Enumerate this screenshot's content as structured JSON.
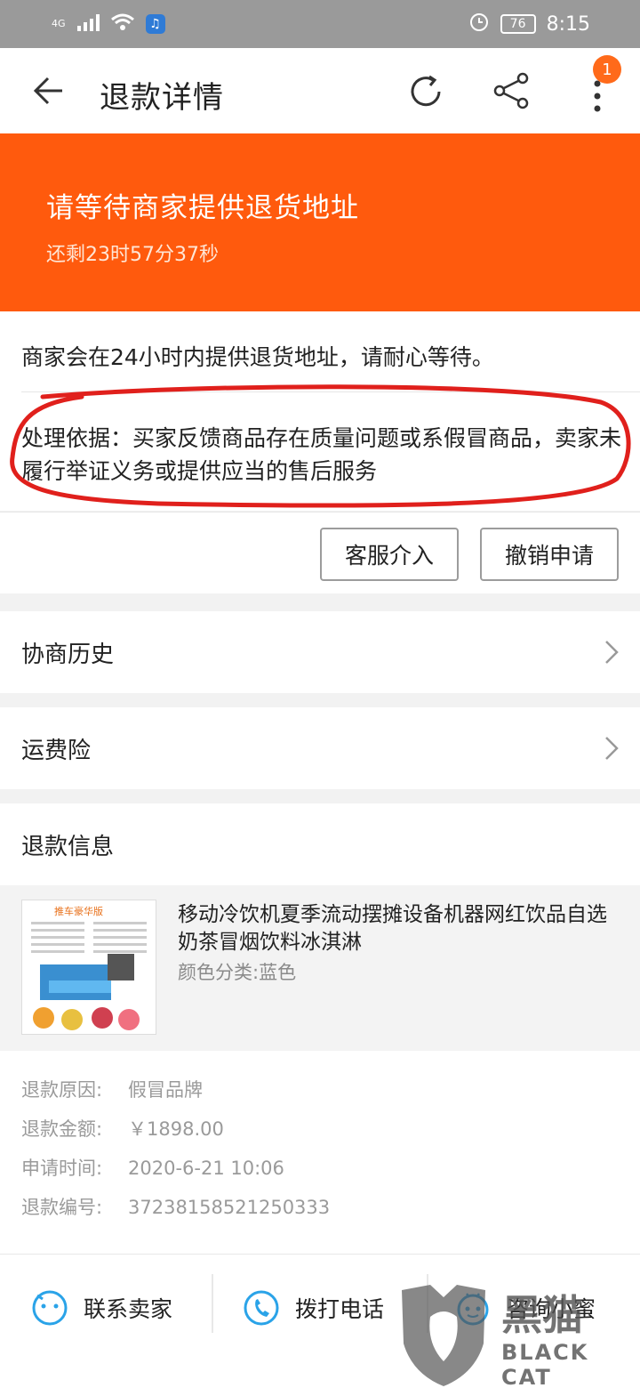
{
  "status_bar": {
    "network": "4G",
    "battery": "76",
    "time": "8:15"
  },
  "header": {
    "title": "退款详情",
    "badge_count": "1",
    "icons": [
      "back-arrow-icon",
      "refresh-icon",
      "share-icon",
      "more-icon"
    ]
  },
  "banner": {
    "title": "请等待商家提供退货地址",
    "countdown": "还剩23时57分37秒",
    "color": "#ff5a0d"
  },
  "notice": {
    "text": "商家会在24小时内提供退货地址，请耐心等待。",
    "basis": "处理依据：买家反馈商品存在质量问题或系假冒商品，卖家未履行举证义务或提供应当的售后服务"
  },
  "actions": {
    "customer_service": "客服介入",
    "cancel": "撤销申请"
  },
  "rows": {
    "history": "协商历史",
    "freight": "运费险"
  },
  "refund_info": {
    "heading": "退款信息",
    "product": {
      "title": "移动冷饮机夏季流动摆摊设备机器网红饮品自选奶茶冒烟饮料冰淇淋",
      "sku": "颜色分类:蓝色",
      "image_banner": "推车豪华版"
    },
    "details": [
      {
        "label": "退款原因:",
        "value": "假冒品牌"
      },
      {
        "label": "退款金额:",
        "value": "￥1898.00"
      },
      {
        "label": "申请时间:",
        "value": "2020-6-21 10:06"
      },
      {
        "label": "退款编号:",
        "value": "37238158521250333"
      }
    ]
  },
  "bottom_bar": {
    "contact_seller": "联系卖家",
    "call": "拨打电话",
    "consult": "咨询小蜜"
  },
  "watermark": {
    "cn": "黑猫",
    "en": "BLACK CAT"
  }
}
